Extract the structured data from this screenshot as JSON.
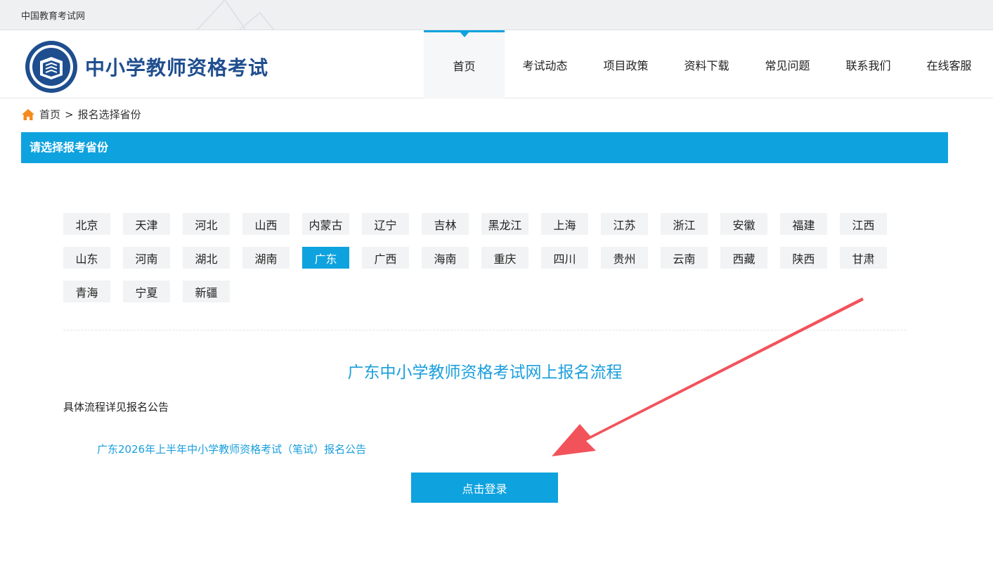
{
  "topbar": {
    "site_name": "中国教育考试网"
  },
  "header": {
    "title": "中小学教师资格考试",
    "nav": [
      {
        "label": "首页",
        "active": true
      },
      {
        "label": "考试动态"
      },
      {
        "label": "项目政策"
      },
      {
        "label": "资料下载"
      },
      {
        "label": "常见问题"
      },
      {
        "label": "联系我们"
      },
      {
        "label": "在线客服"
      }
    ]
  },
  "breadcrumb": {
    "home": "首页",
    "separator": ">",
    "current": "报名选择省份"
  },
  "section": {
    "title": "请选择报考省份"
  },
  "provinces": [
    [
      "北京",
      "天津",
      "河北",
      "山西",
      "内蒙古",
      "辽宁",
      "吉林",
      "黑龙江",
      "上海",
      "江苏",
      "浙江",
      "安徽",
      "福建",
      "江西"
    ],
    [
      "山东",
      "河南",
      "湖北",
      "湖南",
      "广东",
      "广西",
      "海南",
      "重庆",
      "四川",
      "贵州",
      "云南",
      "西藏",
      "陕西",
      "甘肃"
    ],
    [
      "青海",
      "宁夏",
      "新疆"
    ]
  ],
  "selected_province": "广东",
  "flow": {
    "title": "广东中小学教师资格考试网上报名流程",
    "detail": "具体流程详见报名公告",
    "notice_link": "广东2026年上半年中小学教师资格考试（笔试）报名公告",
    "login_button": "点击登录"
  },
  "colors": {
    "accent": "#0ea2df",
    "brand": "#1f4e8f",
    "arrow": "#f2535a"
  },
  "icons": {
    "home": "home-icon",
    "logo": "emblem-logo-icon",
    "annotation": "arrow-annotation"
  }
}
